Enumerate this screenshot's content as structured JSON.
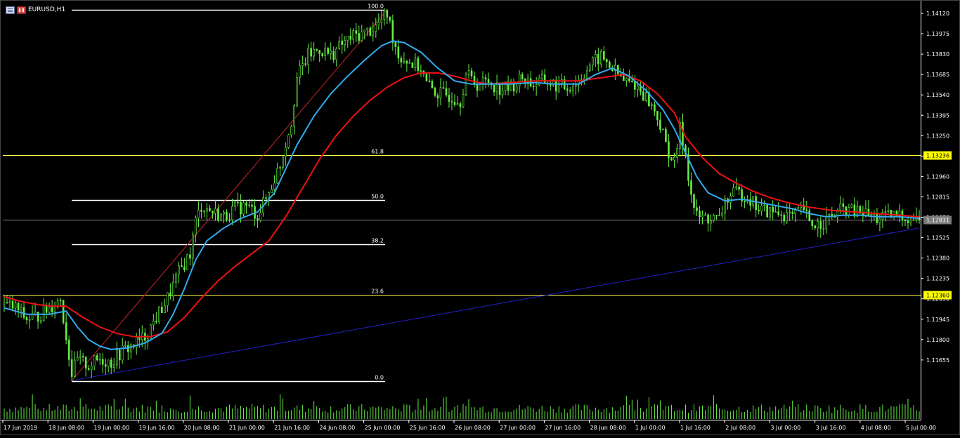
{
  "window": {
    "symbol_title": "EURUSD,H1",
    "icons": [
      "chart-window-icon",
      "restore-window-icon"
    ]
  },
  "colors": {
    "background": "#000000",
    "candles": "#66ee44",
    "fast_ma": "#33aaee",
    "slow_ma": "#ee1111",
    "fibo_levels": "#ffffff",
    "fibo_highlight_levels": "#ffff44",
    "trendline": "#2222cc",
    "fibo_trend": "#cc2222",
    "price_badge_yellow": "#ffff00",
    "price_badge_grey": "#7a7a7a",
    "axis": "#ffffff"
  },
  "price_axis": {
    "labels": [
      "1.14120",
      "1.13975",
      "1.13830",
      "1.13685",
      "1.13540",
      "1.13395",
      "1.13250",
      "1.13105",
      "1.12960",
      "1.12815",
      "1.12670",
      "1.12525",
      "1.12380",
      "1.12235",
      "1.12090",
      "1.11945",
      "1.11800",
      "1.11655"
    ],
    "current_price_badge": "1.12831",
    "fib_61_badge": "1.13236",
    "fib_23_badge": "1.12360"
  },
  "time_axis": {
    "labels": [
      "17 Jun 2019",
      "18 Jun 08:00",
      "19 Jun 00:00",
      "19 Jun 16:00",
      "20 Jun 08:00",
      "21 Jun 00:00",
      "21 Jun 16:00",
      "24 Jun 08:00",
      "25 Jun 00:00",
      "25 Jun 16:00",
      "26 Jun 08:00",
      "27 Jun 00:00",
      "27 Jun 16:00",
      "28 Jun 08:00",
      "1 Jul 00:00",
      "1 Jul 16:00",
      "2 Jul 08:00",
      "3 Jul 00:00",
      "3 Jul 16:00",
      "4 Jul 08:00",
      "5 Jul 00:00"
    ]
  },
  "fibonacci": {
    "levels": [
      {
        "label": "100.0",
        "price": 1.14145,
        "highlight": false
      },
      {
        "label": "61.8",
        "price": 1.13236,
        "highlight": true
      },
      {
        "label": "50.0",
        "price": 1.12956,
        "highlight": false
      },
      {
        "label": "38.2",
        "price": 1.12676,
        "highlight": false
      },
      {
        "label": "23.6",
        "price": 1.1236,
        "highlight": true
      },
      {
        "label": "0.0",
        "price": 1.1182,
        "highlight": false
      }
    ]
  },
  "chart_data": {
    "type": "candlestick",
    "symbol": "EURUSD",
    "timeframe": "H1",
    "y_range": [
      1.1158,
      1.1418
    ],
    "close_path": [
      [
        0,
        1.123
      ],
      [
        4,
        1.1228
      ],
      [
        8,
        1.1221
      ],
      [
        12,
        1.1223
      ],
      [
        16,
        1.1228
      ],
      [
        20,
        1.1234
      ],
      [
        22,
        1.121
      ],
      [
        24,
        1.1187
      ],
      [
        26,
        1.1195
      ],
      [
        30,
        1.1192
      ],
      [
        34,
        1.1196
      ],
      [
        38,
        1.1194
      ],
      [
        42,
        1.1201
      ],
      [
        46,
        1.1205
      ],
      [
        50,
        1.121
      ],
      [
        54,
        1.1222
      ],
      [
        58,
        1.1234
      ],
      [
        62,
        1.125
      ],
      [
        66,
        1.1262
      ],
      [
        68,
        1.1282
      ],
      [
        70,
        1.1292
      ],
      [
        74,
        1.1288
      ],
      [
        78,
        1.1285
      ],
      [
        82,
        1.129
      ],
      [
        86,
        1.1292
      ],
      [
        90,
        1.1286
      ],
      [
        94,
        1.13
      ],
      [
        98,
        1.1318
      ],
      [
        102,
        1.1345
      ],
      [
        104,
        1.1372
      ],
      [
        108,
        1.1386
      ],
      [
        112,
        1.139
      ],
      [
        116,
        1.1386
      ],
      [
        120,
        1.1393
      ],
      [
        124,
        1.1398
      ],
      [
        128,
        1.14
      ],
      [
        132,
        1.1404
      ],
      [
        136,
        1.1412
      ],
      [
        138,
        1.1398
      ],
      [
        140,
        1.1386
      ],
      [
        144,
        1.1382
      ],
      [
        148,
        1.1378
      ],
      [
        150,
        1.1368
      ],
      [
        154,
        1.1362
      ],
      [
        158,
        1.1361
      ],
      [
        162,
        1.1358
      ],
      [
        164,
        1.1374
      ],
      [
        168,
        1.1368
      ],
      [
        172,
        1.137
      ],
      [
        176,
        1.1365
      ],
      [
        180,
        1.1366
      ],
      [
        184,
        1.1372
      ],
      [
        188,
        1.1368
      ],
      [
        192,
        1.137
      ],
      [
        196,
        1.1367
      ],
      [
        200,
        1.1366
      ],
      [
        204,
        1.137
      ],
      [
        208,
        1.138
      ],
      [
        212,
        1.1385
      ],
      [
        216,
        1.1378
      ],
      [
        220,
        1.137
      ],
      [
        224,
        1.1368
      ],
      [
        228,
        1.136
      ],
      [
        232,
        1.1348
      ],
      [
        235,
        1.133
      ],
      [
        238,
        1.1318
      ],
      [
        240,
        1.134
      ],
      [
        242,
        1.1325
      ],
      [
        244,
        1.1298
      ],
      [
        246,
        1.1285
      ],
      [
        250,
        1.1284
      ],
      [
        254,
        1.1283
      ],
      [
        256,
        1.1295
      ],
      [
        260,
        1.13
      ],
      [
        264,
        1.1298
      ],
      [
        268,
        1.129
      ],
      [
        272,
        1.1288
      ],
      [
        276,
        1.1287
      ],
      [
        280,
        1.1285
      ],
      [
        284,
        1.129
      ],
      [
        286,
        1.128
      ],
      [
        290,
        1.1281
      ],
      [
        294,
        1.1285
      ],
      [
        298,
        1.129
      ],
      [
        302,
        1.1288
      ],
      [
        306,
        1.1287
      ],
      [
        310,
        1.1284
      ],
      [
        314,
        1.1285
      ],
      [
        318,
        1.1286
      ],
      [
        322,
        1.1284
      ],
      [
        325,
        1.1283
      ]
    ],
    "fast_ma_path": [
      [
        0,
        1.1228
      ],
      [
        8,
        1.1224
      ],
      [
        16,
        1.1224
      ],
      [
        22,
        1.1226
      ],
      [
        26,
        1.1216
      ],
      [
        30,
        1.1208
      ],
      [
        34,
        1.1204
      ],
      [
        38,
        1.1202
      ],
      [
        44,
        1.1203
      ],
      [
        50,
        1.1206
      ],
      [
        56,
        1.1212
      ],
      [
        60,
        1.1224
      ],
      [
        64,
        1.124
      ],
      [
        68,
        1.1258
      ],
      [
        72,
        1.127
      ],
      [
        78,
        1.1278
      ],
      [
        84,
        1.1284
      ],
      [
        90,
        1.1288
      ],
      [
        96,
        1.13
      ],
      [
        100,
        1.1315
      ],
      [
        104,
        1.133
      ],
      [
        110,
        1.1348
      ],
      [
        116,
        1.1362
      ],
      [
        122,
        1.1373
      ],
      [
        128,
        1.1383
      ],
      [
        134,
        1.1392
      ],
      [
        138,
        1.1395
      ],
      [
        142,
        1.1394
      ],
      [
        148,
        1.1388
      ],
      [
        154,
        1.1378
      ],
      [
        160,
        1.137
      ],
      [
        166,
        1.1368
      ],
      [
        172,
        1.1368
      ],
      [
        180,
        1.1368
      ],
      [
        188,
        1.1369
      ],
      [
        196,
        1.1368
      ],
      [
        204,
        1.1368
      ],
      [
        210,
        1.1374
      ],
      [
        216,
        1.1378
      ],
      [
        222,
        1.1373
      ],
      [
        228,
        1.1364
      ],
      [
        234,
        1.1352
      ],
      [
        238,
        1.134
      ],
      [
        242,
        1.1325
      ],
      [
        246,
        1.131
      ],
      [
        250,
        1.13
      ],
      [
        256,
        1.1295
      ],
      [
        262,
        1.1296
      ],
      [
        268,
        1.1294
      ],
      [
        274,
        1.1292
      ],
      [
        280,
        1.129
      ],
      [
        286,
        1.1287
      ],
      [
        292,
        1.1285
      ],
      [
        298,
        1.1286
      ],
      [
        304,
        1.1286
      ],
      [
        310,
        1.1285
      ],
      [
        318,
        1.1285
      ],
      [
        325,
        1.1284
      ]
    ],
    "slow_ma_path": [
      [
        0,
        1.1235
      ],
      [
        6,
        1.1232
      ],
      [
        12,
        1.123
      ],
      [
        18,
        1.1229
      ],
      [
        22,
        1.1229
      ],
      [
        28,
        1.1222
      ],
      [
        34,
        1.1216
      ],
      [
        40,
        1.1212
      ],
      [
        46,
        1.121
      ],
      [
        52,
        1.121
      ],
      [
        58,
        1.1213
      ],
      [
        64,
        1.1222
      ],
      [
        70,
        1.1234
      ],
      [
        76,
        1.1245
      ],
      [
        82,
        1.1254
      ],
      [
        88,
        1.1262
      ],
      [
        94,
        1.127
      ],
      [
        100,
        1.1285
      ],
      [
        106,
        1.1303
      ],
      [
        112,
        1.1321
      ],
      [
        118,
        1.1336
      ],
      [
        124,
        1.1348
      ],
      [
        130,
        1.1358
      ],
      [
        136,
        1.1366
      ],
      [
        142,
        1.1372
      ],
      [
        148,
        1.1375
      ],
      [
        154,
        1.1375
      ],
      [
        160,
        1.1373
      ],
      [
        166,
        1.137
      ],
      [
        172,
        1.1368
      ],
      [
        180,
        1.1369
      ],
      [
        188,
        1.137
      ],
      [
        196,
        1.137
      ],
      [
        204,
        1.137
      ],
      [
        212,
        1.1372
      ],
      [
        220,
        1.1374
      ],
      [
        226,
        1.137
      ],
      [
        232,
        1.1362
      ],
      [
        238,
        1.135
      ],
      [
        242,
        1.1335
      ],
      [
        248,
        1.1322
      ],
      [
        254,
        1.1312
      ],
      [
        260,
        1.1306
      ],
      [
        266,
        1.1301
      ],
      [
        272,
        1.1297
      ],
      [
        278,
        1.1294
      ],
      [
        286,
        1.1291
      ],
      [
        294,
        1.1289
      ],
      [
        302,
        1.1288
      ],
      [
        310,
        1.1287
      ],
      [
        318,
        1.1286
      ],
      [
        325,
        1.1285
      ]
    ],
    "trendline": {
      "from_bar": 24,
      "from_price": 1.11825,
      "to_bar": 325,
      "to_price": 1.1278
    },
    "fibo_trendline": {
      "from_bar": 24,
      "from_price": 1.11825,
      "to_bar": 136,
      "to_price": 1.14145
    },
    "volume_profile": "relative bar heights 0..1 estimated",
    "volume_seed": 7
  }
}
